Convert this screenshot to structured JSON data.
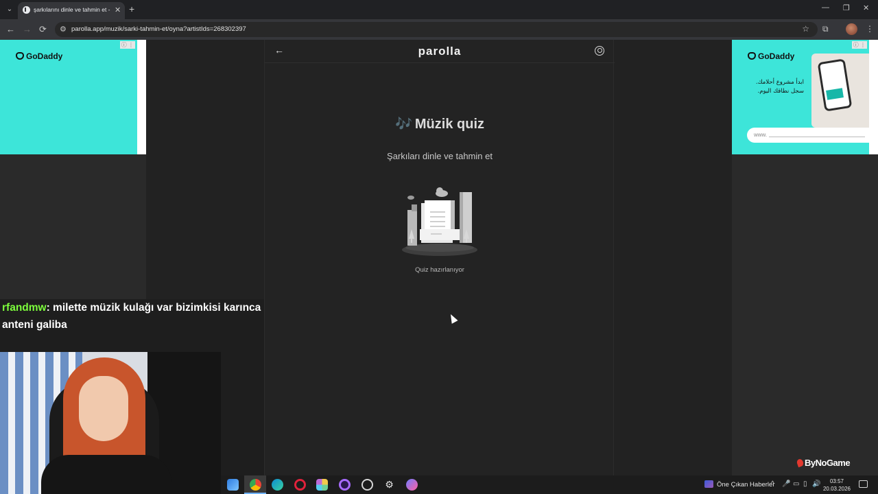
{
  "browser": {
    "tab_title": "şarkılarını dinle ve tahmin et - P",
    "tab_close": "✕",
    "new_tab": "+",
    "tab_list": "⌄",
    "url": "parolla.app/muzik/sarki-tahmin-et/oyna?artistIds=268302397",
    "back": "←",
    "forward": "→",
    "reload": "⟳",
    "minimize": "—",
    "restore": "❐",
    "close": "✕",
    "bookmark": "☆",
    "extensions": "⧉",
    "menu": "⋮"
  },
  "ads": {
    "left": {
      "brand": "GoDaddy",
      "choice": "ⓘ ⋮"
    },
    "right": {
      "brand": "GoDaddy",
      "arabic_text": "ابدأ مشروع أحلامك. سجل نطاقك اليوم.",
      "input_prefix": "www.",
      "choice": "ⓘ ⋮"
    }
  },
  "app": {
    "brand": "parolla",
    "back_icon": "←",
    "title_icon": "🎶",
    "title": "Müzik quiz",
    "subtitle": "Şarkıları dinle ve tahmin et",
    "loading_text": "Quiz hazırlanıyor"
  },
  "chat": {
    "username": "rfandmw",
    "message": ": milette müzik kulağı var bizimkisi karınca anteni galiba"
  },
  "watermark": "ByNoGame",
  "taskbar": {
    "news": "Öne Çıkan Haberler",
    "time": "03:57",
    "date": "20.03.2026",
    "tray_chevron": "^",
    "tray_mic": "🎤",
    "tray_volume": "🔊"
  },
  "colors": {
    "ad_bg": "#3de5d9",
    "chat_user": "#7dff3c",
    "app_bg": "#232323",
    "page_bg": "#1e1e1e"
  }
}
